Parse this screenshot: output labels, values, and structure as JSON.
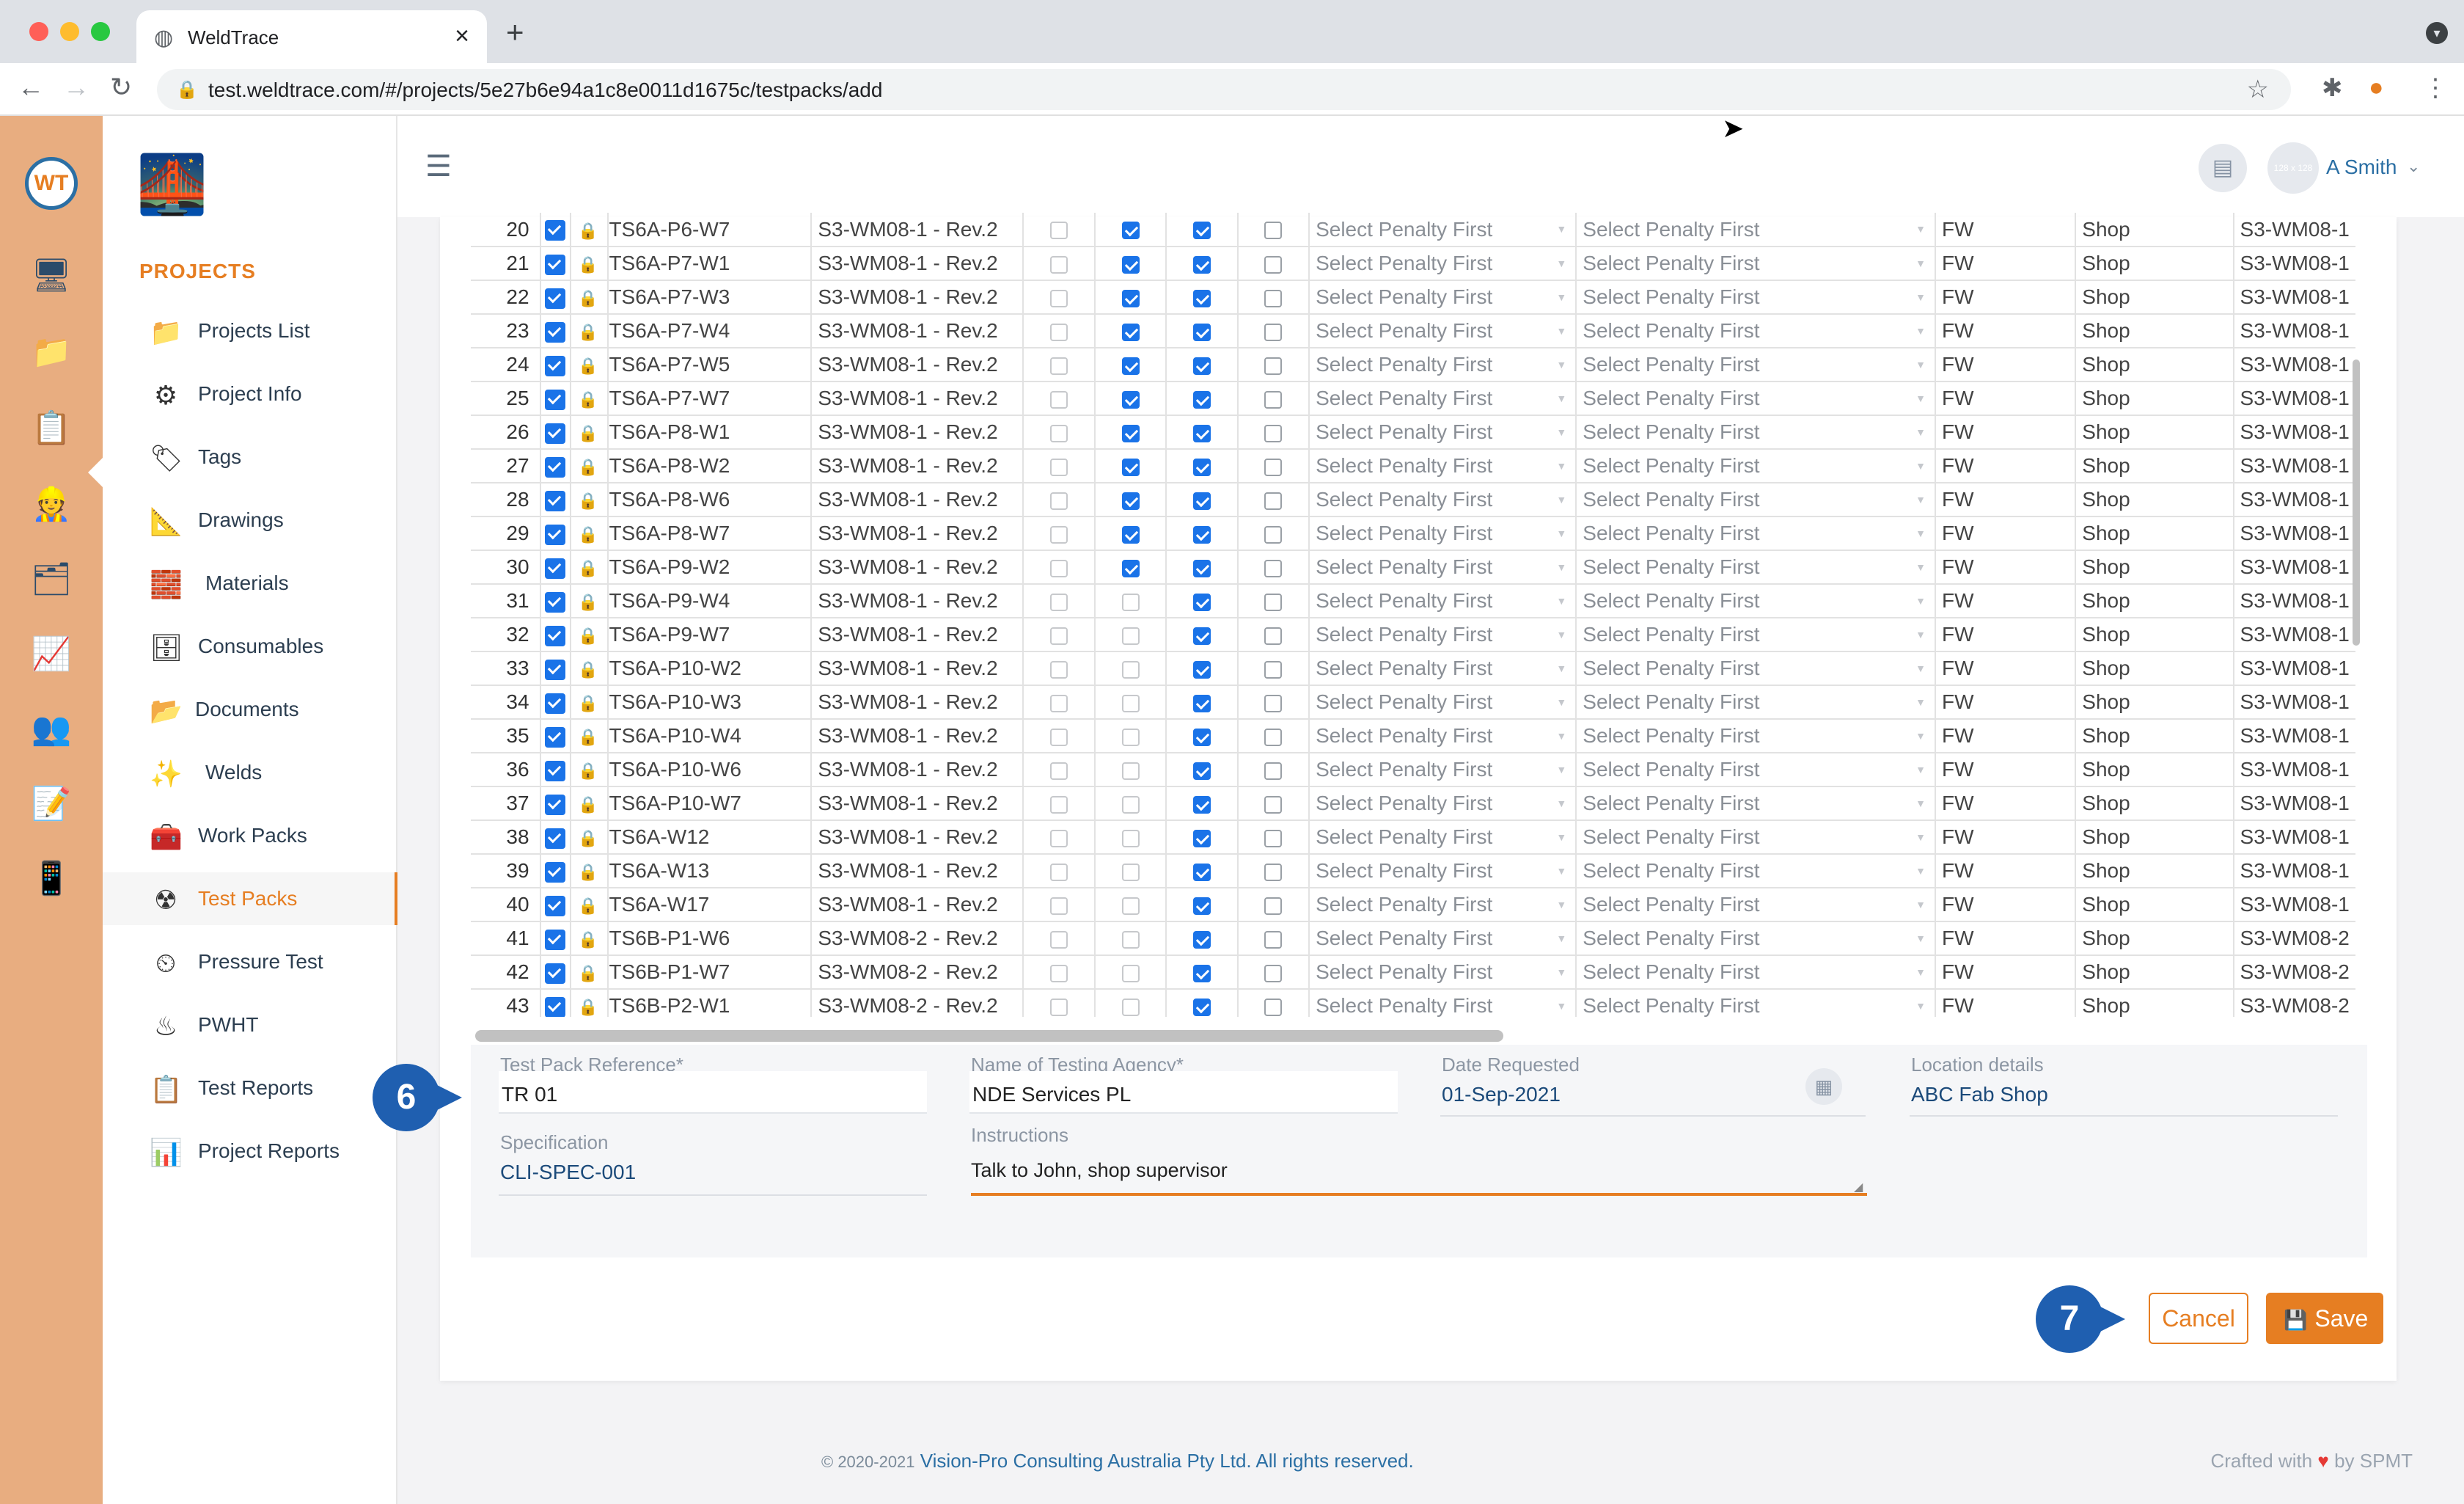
{
  "browser": {
    "tab_title": "WeldTrace",
    "url": "test.weldtrace.com/#/projects/5e27b6e94a1c8e0011d1675c/testpacks/add"
  },
  "header": {
    "avatar_text": "128 x 128",
    "user_name": "A Smith"
  },
  "sidebar": {
    "heading": "PROJECTS",
    "items": [
      {
        "label": "Projects List",
        "icon": "folder-camera-icon",
        "glyph": "📁"
      },
      {
        "label": "Project Info",
        "icon": "gears-icon",
        "glyph": "⚙"
      },
      {
        "label": "Tags",
        "icon": "tag-icon",
        "glyph": "🏷"
      },
      {
        "label": "Drawings",
        "icon": "drawing-tools-icon",
        "glyph": "📐"
      },
      {
        "label": "Materials",
        "icon": "pipes-icon",
        "glyph": "🧱"
      },
      {
        "label": "Consumables",
        "icon": "rods-icon",
        "glyph": "🗄"
      },
      {
        "label": "Documents",
        "icon": "folder-icon",
        "glyph": "📂"
      },
      {
        "label": "Welds",
        "icon": "weld-spark-icon",
        "glyph": "✨"
      },
      {
        "label": "Work Packs",
        "icon": "toolbox-icon",
        "glyph": "🧰"
      },
      {
        "label": "Test Packs",
        "icon": "radiation-icon",
        "glyph": "☢"
      },
      {
        "label": "Pressure Test",
        "icon": "gauge-icon",
        "glyph": "⏲"
      },
      {
        "label": "PWHT",
        "icon": "heater-icon",
        "glyph": "♨"
      },
      {
        "label": "Test Reports",
        "icon": "report-list-icon",
        "glyph": "📋"
      },
      {
        "label": "Project Reports",
        "icon": "report-chart-icon",
        "glyph": "📊"
      }
    ]
  },
  "table": {
    "select_placeholder": "Select Penalty First",
    "rows": [
      {
        "n": "20",
        "weld": "TS6A-P6-W7",
        "wps": "S3-WM08-1 - Rev.2",
        "c3": true,
        "type": "FW",
        "loc": "Shop",
        "ref": "S3-WM08-1"
      },
      {
        "n": "21",
        "weld": "TS6A-P7-W1",
        "wps": "S3-WM08-1 - Rev.2",
        "c3": true,
        "type": "FW",
        "loc": "Shop",
        "ref": "S3-WM08-1"
      },
      {
        "n": "22",
        "weld": "TS6A-P7-W3",
        "wps": "S3-WM08-1 - Rev.2",
        "c3": true,
        "type": "FW",
        "loc": "Shop",
        "ref": "S3-WM08-1"
      },
      {
        "n": "23",
        "weld": "TS6A-P7-W4",
        "wps": "S3-WM08-1 - Rev.2",
        "c3": true,
        "type": "FW",
        "loc": "Shop",
        "ref": "S3-WM08-1"
      },
      {
        "n": "24",
        "weld": "TS6A-P7-W5",
        "wps": "S3-WM08-1 - Rev.2",
        "c3": true,
        "type": "FW",
        "loc": "Shop",
        "ref": "S3-WM08-1"
      },
      {
        "n": "25",
        "weld": "TS6A-P7-W7",
        "wps": "S3-WM08-1 - Rev.2",
        "c3": true,
        "type": "FW",
        "loc": "Shop",
        "ref": "S3-WM08-1"
      },
      {
        "n": "26",
        "weld": "TS6A-P8-W1",
        "wps": "S3-WM08-1 - Rev.2",
        "c3": true,
        "type": "FW",
        "loc": "Shop",
        "ref": "S3-WM08-1"
      },
      {
        "n": "27",
        "weld": "TS6A-P8-W2",
        "wps": "S3-WM08-1 - Rev.2",
        "c3": true,
        "type": "FW",
        "loc": "Shop",
        "ref": "S3-WM08-1"
      },
      {
        "n": "28",
        "weld": "TS6A-P8-W6",
        "wps": "S3-WM08-1 - Rev.2",
        "c3": true,
        "type": "FW",
        "loc": "Shop",
        "ref": "S3-WM08-1"
      },
      {
        "n": "29",
        "weld": "TS6A-P8-W7",
        "wps": "S3-WM08-1 - Rev.2",
        "c3": true,
        "type": "FW",
        "loc": "Shop",
        "ref": "S3-WM08-1"
      },
      {
        "n": "30",
        "weld": "TS6A-P9-W2",
        "wps": "S3-WM08-1 - Rev.2",
        "c3": true,
        "type": "FW",
        "loc": "Shop",
        "ref": "S3-WM08-1"
      },
      {
        "n": "31",
        "weld": "TS6A-P9-W4",
        "wps": "S3-WM08-1 - Rev.2",
        "c3": false,
        "type": "FW",
        "loc": "Shop",
        "ref": "S3-WM08-1"
      },
      {
        "n": "32",
        "weld": "TS6A-P9-W7",
        "wps": "S3-WM08-1 - Rev.2",
        "c3": false,
        "type": "FW",
        "loc": "Shop",
        "ref": "S3-WM08-1"
      },
      {
        "n": "33",
        "weld": "TS6A-P10-W2",
        "wps": "S3-WM08-1 - Rev.2",
        "c3": false,
        "type": "FW",
        "loc": "Shop",
        "ref": "S3-WM08-1"
      },
      {
        "n": "34",
        "weld": "TS6A-P10-W3",
        "wps": "S3-WM08-1 - Rev.2",
        "c3": false,
        "type": "FW",
        "loc": "Shop",
        "ref": "S3-WM08-1"
      },
      {
        "n": "35",
        "weld": "TS6A-P10-W4",
        "wps": "S3-WM08-1 - Rev.2",
        "c3": false,
        "type": "FW",
        "loc": "Shop",
        "ref": "S3-WM08-1"
      },
      {
        "n": "36",
        "weld": "TS6A-P10-W6",
        "wps": "S3-WM08-1 - Rev.2",
        "c3": false,
        "type": "FW",
        "loc": "Shop",
        "ref": "S3-WM08-1"
      },
      {
        "n": "37",
        "weld": "TS6A-P10-W7",
        "wps": "S3-WM08-1 - Rev.2",
        "c3": false,
        "type": "FW",
        "loc": "Shop",
        "ref": "S3-WM08-1"
      },
      {
        "n": "38",
        "weld": "TS6A-W12",
        "wps": "S3-WM08-1 - Rev.2",
        "c3": false,
        "type": "FW",
        "loc": "Shop",
        "ref": "S3-WM08-1"
      },
      {
        "n": "39",
        "weld": "TS6A-W13",
        "wps": "S3-WM08-1 - Rev.2",
        "c3": false,
        "type": "FW",
        "loc": "Shop",
        "ref": "S3-WM08-1"
      },
      {
        "n": "40",
        "weld": "TS6A-W17",
        "wps": "S3-WM08-1 - Rev.2",
        "c3": false,
        "type": "FW",
        "loc": "Shop",
        "ref": "S3-WM08-1"
      },
      {
        "n": "41",
        "weld": "TS6B-P1-W6",
        "wps": "S3-WM08-2 - Rev.2",
        "c3": false,
        "type": "FW",
        "loc": "Shop",
        "ref": "S3-WM08-2"
      },
      {
        "n": "42",
        "weld": "TS6B-P1-W7",
        "wps": "S3-WM08-2 - Rev.2",
        "c3": false,
        "type": "FW",
        "loc": "Shop",
        "ref": "S3-WM08-2"
      },
      {
        "n": "43",
        "weld": "TS6B-P2-W1",
        "wps": "S3-WM08-2 - Rev.2",
        "c3": false,
        "type": "FW",
        "loc": "Shop",
        "ref": "S3-WM08-2"
      }
    ]
  },
  "form": {
    "test_pack_reference": {
      "label": "Test Pack Reference*",
      "value": "TR 01"
    },
    "testing_agency": {
      "label": "Name of Testing Agency*",
      "value": "NDE Services PL"
    },
    "date_requested": {
      "label": "Date Requested",
      "value": "01-Sep-2021"
    },
    "location_details": {
      "label": "Location details",
      "value": "ABC Fab Shop"
    },
    "specification": {
      "label": "Specification",
      "value": "CLI-SPEC-001"
    },
    "instructions": {
      "label": "Instructions",
      "value": "Talk to John, shop supervisor"
    }
  },
  "annotations": {
    "step_6": "6",
    "step_7": "7"
  },
  "actions": {
    "cancel_label": "Cancel",
    "save_label": "Save"
  },
  "footer": {
    "copyright_prefix": "© 2020-2021",
    "company": "Vision-Pro Consulting Australia Pty Ltd. All rights reserved.",
    "crafted_prefix": "Crafted with",
    "crafted_suffix": "by SPMT"
  },
  "colors": {
    "accent": "#e67e22",
    "link": "#2b6fa4",
    "rail": "#e8ad80",
    "step": "#1f5fb0"
  }
}
